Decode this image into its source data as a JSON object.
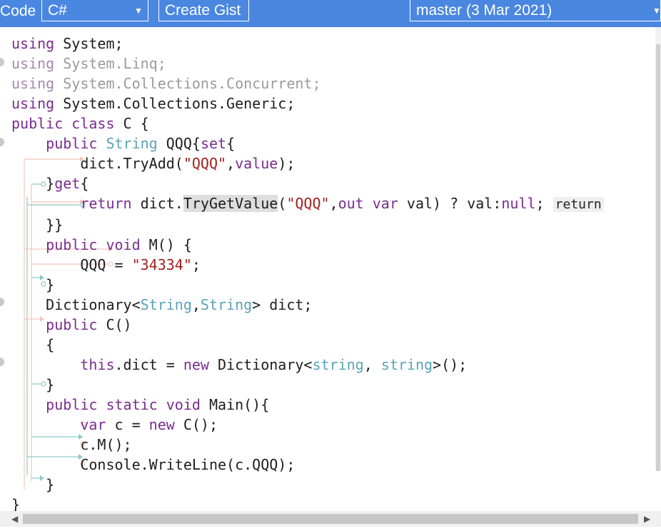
{
  "toolbar": {
    "mode_label": "Code",
    "language_value": "C#",
    "create_gist_label": "Create Gist",
    "branch_value": "master (3 Mar 2021)",
    "dropdown_caret": "▼"
  },
  "editor": {
    "language": "C#",
    "lines": [
      "using System;",
      "using System.Linq;",
      "using System.Collections.Concurrent;",
      "using System.Collections.Generic;",
      "public class C {",
      "    public String QQQ{set{",
      "        dict.TryAdd(\"QQQ\",value);",
      "    }get{",
      "        return dict.TryGetValue(\"QQQ\",out var val) ? val:null;",
      "    }}",
      "    public void M() {",
      "        QQQ = \"34334\";",
      "    }",
      "    Dictionary<String,String> dict;",
      "    public C()",
      "    {",
      "        this.dict = new Dictionary<string, string>();",
      "    }",
      "    public static void Main(){",
      "        var c = new C();",
      "        c.M();",
      "        Console.WriteLine(c.QQQ);",
      "    }",
      "}"
    ],
    "inline_hint": "return"
  },
  "colors": {
    "toolbar_bg": "#4a87e0",
    "keyword": "#7a2c8f",
    "type": "#5aa3b8",
    "string": "#a3201e",
    "flow_orange": "#f0c8b8",
    "flow_teal": "#8cc9c9"
  },
  "icons": [
    "dropdown-caret-icon",
    "scroll-left-icon",
    "scroll-right-icon",
    "breakpoint-dot-icon"
  ]
}
